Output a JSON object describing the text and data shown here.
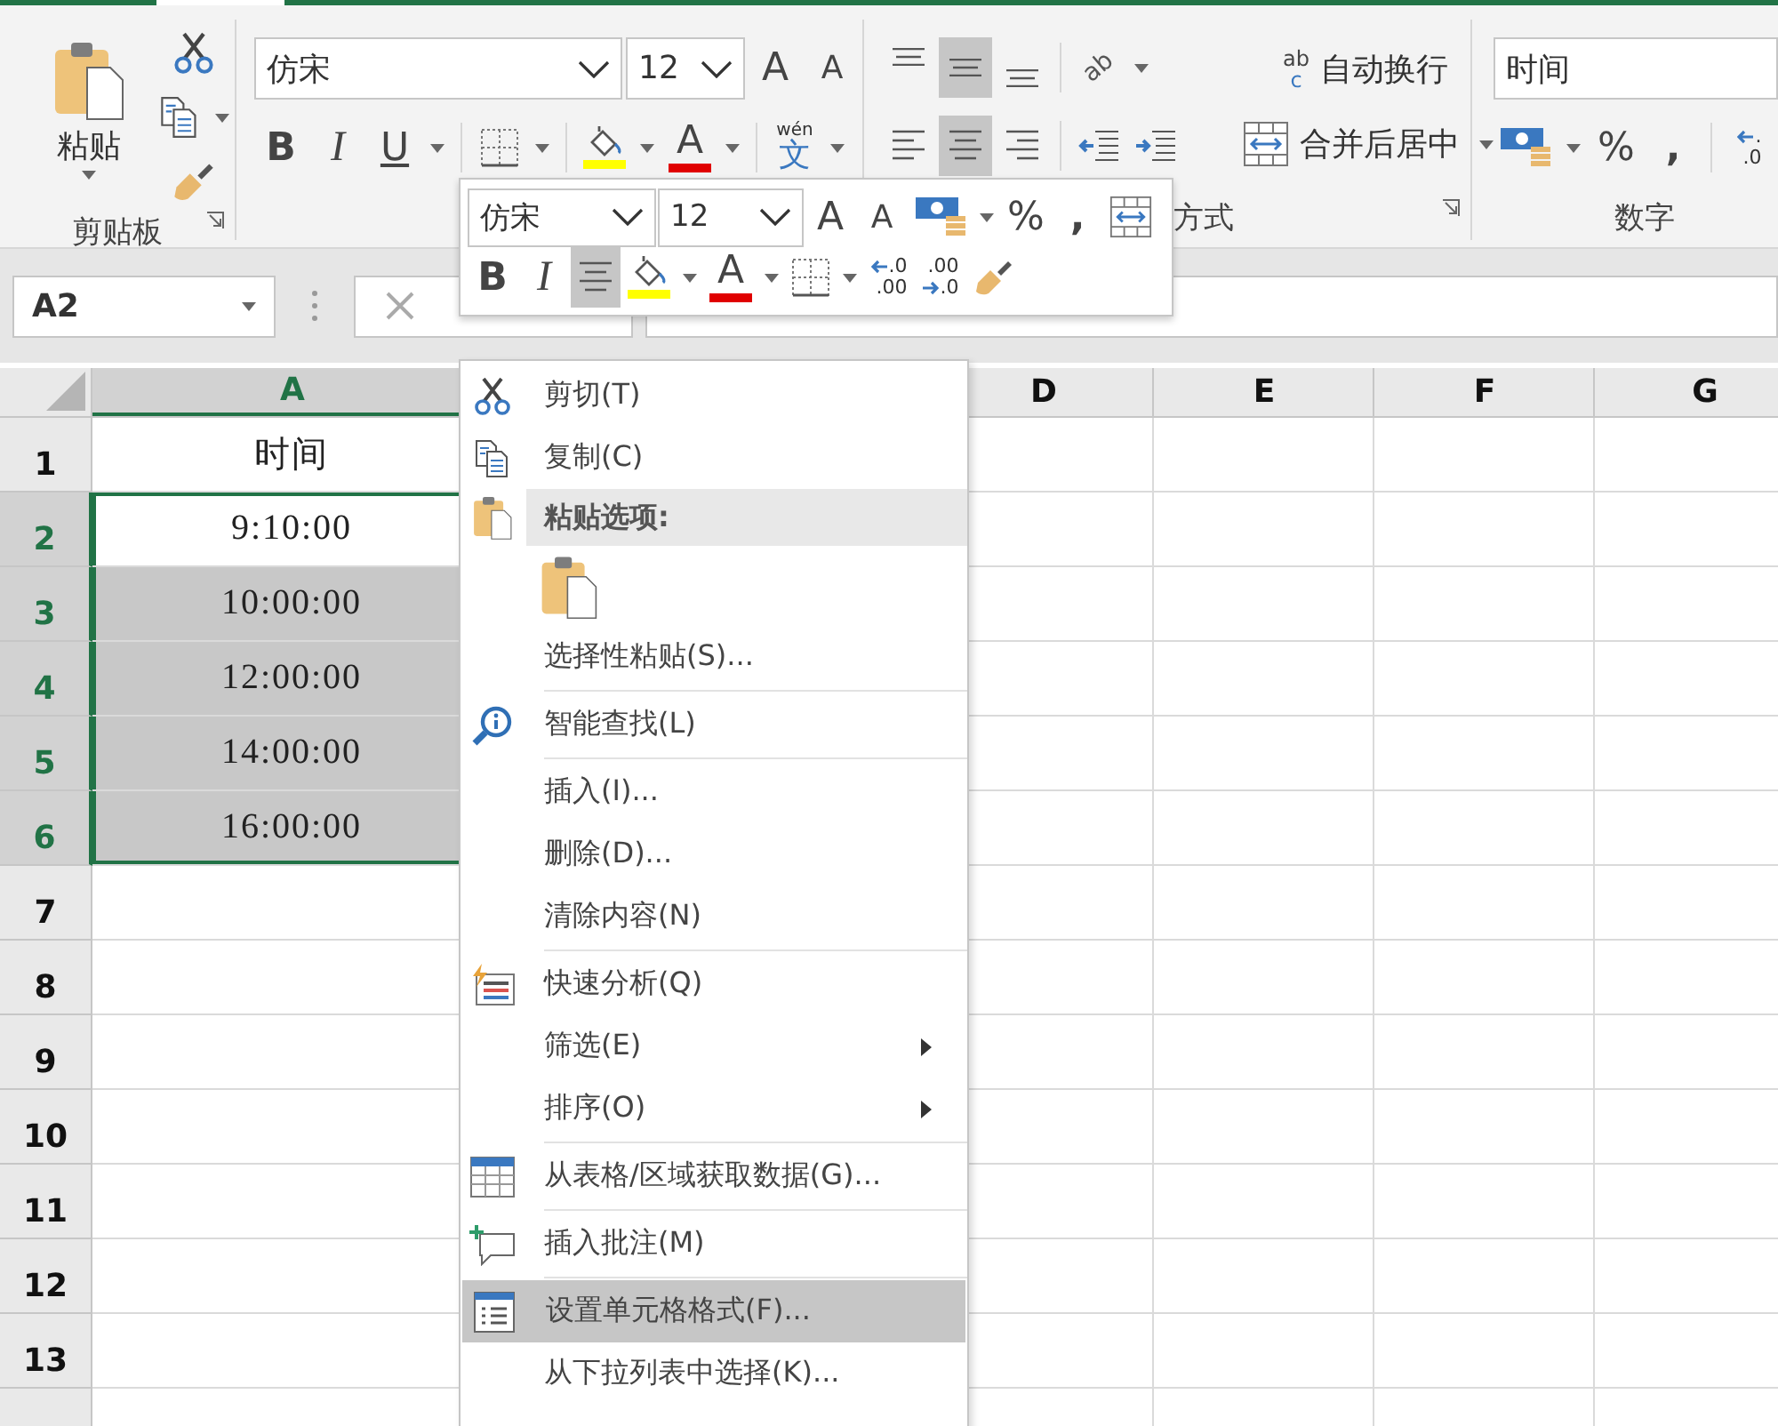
{
  "ribbon": {
    "clipboard": {
      "paste_label": "粘贴",
      "group_label": "剪贴板"
    },
    "font": {
      "font_name": "仿宋",
      "font_size": "12",
      "grow_label": "A",
      "shrink_label": "A",
      "bold_label": "B",
      "italic_label": "I",
      "underline_label": "U",
      "font_color_label": "A",
      "phonetic_pinyin": "wén",
      "phonetic_character": "文"
    },
    "alignment": {
      "vertical_align": [
        {
          "selected": false
        },
        {
          "selected": true
        },
        {
          "selected": false
        }
      ],
      "horizontal_align": [
        {
          "selected": false
        },
        {
          "selected": true
        },
        {
          "selected": false
        }
      ],
      "orientation_label": "ab",
      "wrap_icon_top": "ab",
      "wrap_icon_bottom": "c",
      "wrap_text": "自动换行",
      "merge_center": "合并后居中",
      "group_label": "方式"
    },
    "number": {
      "format": "时间",
      "percent": "%",
      "comma": ",",
      "decimal_top": ".",
      "decimal_bottom": ".0",
      "group_label": "数字"
    }
  },
  "formula_bar": {
    "name_box": "A2"
  },
  "sheet": {
    "columns": [
      {
        "label": "A",
        "selected": true
      },
      {
        "label": "D",
        "selected": false
      },
      {
        "label": "E",
        "selected": false
      },
      {
        "label": "F",
        "selected": false
      },
      {
        "label": "G",
        "selected": false
      }
    ],
    "rows": [
      {
        "label": "1",
        "selected": false,
        "cells": [
          {
            "value": "时间",
            "selected": false
          }
        ]
      },
      {
        "label": "2",
        "selected": true,
        "cells": [
          {
            "value": "9:10:00",
            "selected": true,
            "active": true
          }
        ]
      },
      {
        "label": "3",
        "selected": true,
        "cells": [
          {
            "value": "10:00:00",
            "selected": true,
            "active": false
          }
        ]
      },
      {
        "label": "4",
        "selected": true,
        "cells": [
          {
            "value": "12:00:00",
            "selected": true,
            "active": false
          }
        ]
      },
      {
        "label": "5",
        "selected": true,
        "cells": [
          {
            "value": "14:00:00",
            "selected": true,
            "active": false
          }
        ]
      },
      {
        "label": "6",
        "selected": true,
        "cells": [
          {
            "value": "16:00:00",
            "selected": true,
            "active": false
          }
        ]
      },
      {
        "label": "7",
        "selected": false,
        "cells": []
      },
      {
        "label": "8",
        "selected": false,
        "cells": []
      },
      {
        "label": "9",
        "selected": false,
        "cells": []
      },
      {
        "label": "10",
        "selected": false,
        "cells": []
      },
      {
        "label": "11",
        "selected": false,
        "cells": []
      },
      {
        "label": "12",
        "selected": false,
        "cells": []
      },
      {
        "label": "13",
        "selected": false,
        "cells": []
      }
    ]
  },
  "mini_toolbar": {
    "font_name": "仿宋",
    "font_size": "12",
    "grow_label": "A",
    "shrink_label": "A",
    "percent": "%",
    "comma": ",",
    "bold_label": "B",
    "italic_label": "I",
    "center_align": {
      "selected": true
    },
    "font_color_label": "A",
    "increase_decimal": {
      "top": ".0",
      "bottom": ".00"
    },
    "decrease_decimal": {
      "top": ".00",
      "bottom": ".0"
    }
  },
  "context_menu": {
    "items": [
      {
        "kind": "command",
        "label": "剪切(T)",
        "submenu": false,
        "selected": false
      },
      {
        "kind": "command",
        "label": "复制(C)",
        "submenu": false,
        "selected": false
      },
      {
        "kind": "header",
        "label": "粘贴选项:"
      },
      {
        "kind": "paste_options"
      },
      {
        "kind": "command",
        "label": "选择性粘贴(S)...",
        "submenu": false,
        "selected": false
      },
      {
        "kind": "separator"
      },
      {
        "kind": "command",
        "label": "智能查找(L)",
        "submenu": false,
        "selected": false
      },
      {
        "kind": "separator"
      },
      {
        "kind": "command",
        "label": "插入(I)...",
        "submenu": false,
        "selected": false
      },
      {
        "kind": "command",
        "label": "删除(D)...",
        "submenu": false,
        "selected": false
      },
      {
        "kind": "command",
        "label": "清除内容(N)",
        "submenu": false,
        "selected": false
      },
      {
        "kind": "separator"
      },
      {
        "kind": "command",
        "label": "快速分析(Q)",
        "submenu": false,
        "selected": false
      },
      {
        "kind": "command",
        "label": "筛选(E)",
        "submenu": true,
        "selected": false
      },
      {
        "kind": "command",
        "label": "排序(O)",
        "submenu": true,
        "selected": false
      },
      {
        "kind": "separator"
      },
      {
        "kind": "command",
        "label": "从表格/区域获取数据(G)...",
        "submenu": false,
        "selected": false
      },
      {
        "kind": "separator"
      },
      {
        "kind": "command",
        "label": "插入批注(M)",
        "submenu": false,
        "selected": false
      },
      {
        "kind": "separator"
      },
      {
        "kind": "command",
        "label": "设置单元格格式(F)...",
        "submenu": false,
        "selected": true
      },
      {
        "kind": "command",
        "label": "从下拉列表中选择(K)...",
        "submenu": false,
        "selected": false
      }
    ]
  }
}
